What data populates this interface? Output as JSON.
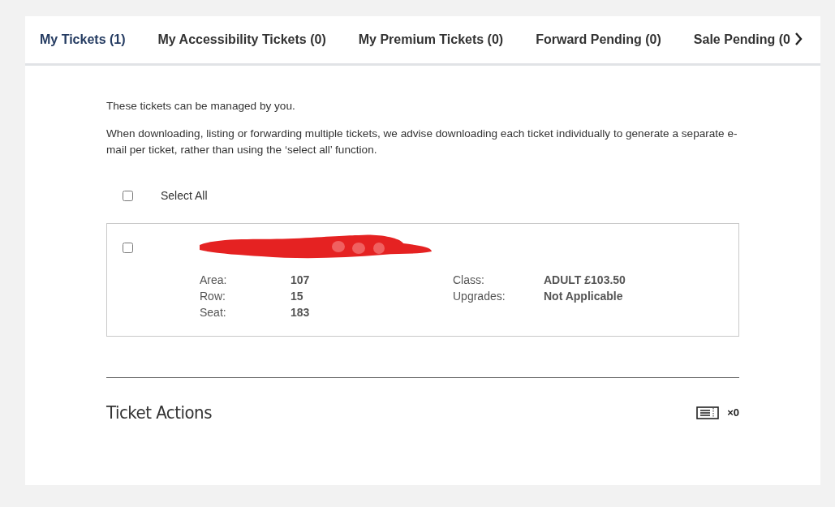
{
  "tabs": [
    {
      "label": "My Tickets (1)",
      "selected": true
    },
    {
      "label": "My Accessibility Tickets (0)",
      "selected": false
    },
    {
      "label": "My Premium Tickets (0)",
      "selected": false
    },
    {
      "label": "Forward Pending (0)",
      "selected": false
    },
    {
      "label": "Sale Pending (0",
      "selected": false
    }
  ],
  "intro": "These tickets can be managed by you.",
  "advice": "When downloading, listing or forwarding multiple tickets, we advise downloading each ticket individually to generate a separate e-mail per ticket, rather than using the ‘select all’ function.",
  "select_all": {
    "label": "Select All",
    "checked": false
  },
  "tickets": [
    {
      "checked": false,
      "redacted": true,
      "details_left": [
        {
          "label": "Area:",
          "value": "107"
        },
        {
          "label": "Row:",
          "value": "15"
        },
        {
          "label": "Seat:",
          "value": "183"
        }
      ],
      "details_right": [
        {
          "label": "Class:",
          "value": "ADULT £103.50"
        },
        {
          "label": "Upgrades:",
          "value": "Not Applicable"
        }
      ]
    }
  ],
  "actions": {
    "title": "Ticket Actions",
    "count": "×0"
  }
}
